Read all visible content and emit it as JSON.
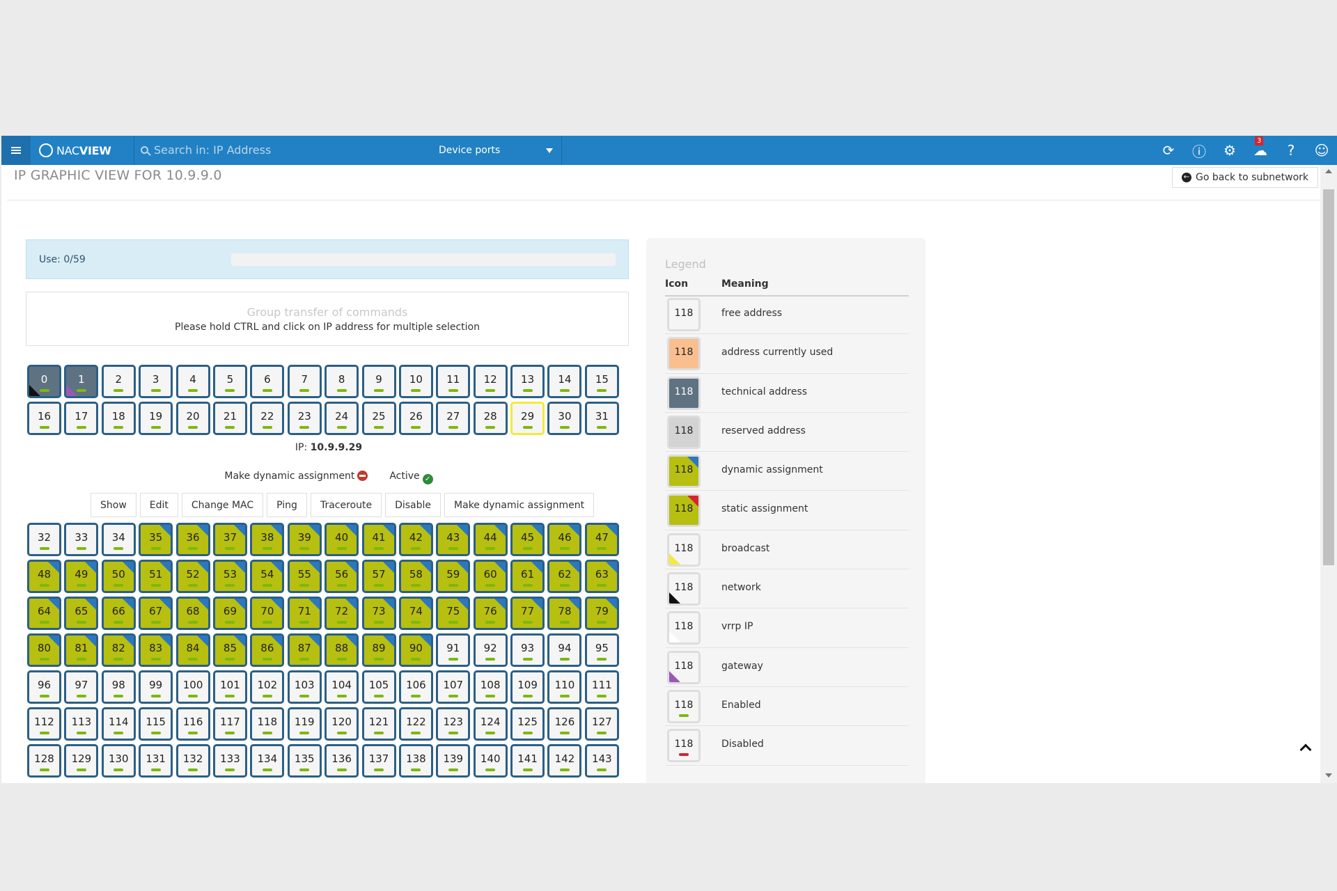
{
  "navbar": {
    "logo_prefix": "NAC",
    "logo_suffix": "VIEW",
    "search_placeholder": "Search in: IP Address",
    "device_select": "Device ports",
    "notification_count": "3",
    "icons": [
      "refresh-icon",
      "alert-icon",
      "gear-icon",
      "notification-icon",
      "help-icon",
      "user-icon"
    ]
  },
  "page": {
    "title": "IP GRAPHIC VIEW FOR 10.9.9.0",
    "back_button": "Go back to subnetwork"
  },
  "usage": {
    "label": "Use: 0/59",
    "percent": 0
  },
  "group": {
    "title": "Group transfer of commands",
    "hint": "Please hold CTRL and click on IP address for multiple selection"
  },
  "selected": {
    "ip_label": "IP:",
    "ip": "10.9.9.29",
    "dynamic_label": "Make dynamic assignment",
    "active_label": "Active"
  },
  "actions": [
    "Show",
    "Edit",
    "Change MAC",
    "Ping",
    "Traceroute",
    "Disable",
    "Make dynamic assignment"
  ],
  "ip_grid_top": [
    {
      "n": "0",
      "t": "tech net"
    },
    {
      "n": "1",
      "t": "tech gw"
    },
    {
      "n": "2",
      "t": ""
    },
    {
      "n": "3",
      "t": ""
    },
    {
      "n": "4",
      "t": ""
    },
    {
      "n": "5",
      "t": ""
    },
    {
      "n": "6",
      "t": ""
    },
    {
      "n": "7",
      "t": ""
    },
    {
      "n": "8",
      "t": ""
    },
    {
      "n": "9",
      "t": ""
    },
    {
      "n": "10",
      "t": ""
    },
    {
      "n": "11",
      "t": ""
    },
    {
      "n": "12",
      "t": ""
    },
    {
      "n": "13",
      "t": ""
    },
    {
      "n": "14",
      "t": ""
    },
    {
      "n": "15",
      "t": ""
    },
    {
      "n": "16",
      "t": ""
    },
    {
      "n": "17",
      "t": ""
    },
    {
      "n": "18",
      "t": ""
    },
    {
      "n": "19",
      "t": ""
    },
    {
      "n": "20",
      "t": ""
    },
    {
      "n": "21",
      "t": ""
    },
    {
      "n": "22",
      "t": ""
    },
    {
      "n": "23",
      "t": ""
    },
    {
      "n": "24",
      "t": ""
    },
    {
      "n": "25",
      "t": ""
    },
    {
      "n": "26",
      "t": ""
    },
    {
      "n": "27",
      "t": ""
    },
    {
      "n": "28",
      "t": ""
    },
    {
      "n": "29",
      "t": "selected"
    },
    {
      "n": "30",
      "t": ""
    },
    {
      "n": "31",
      "t": ""
    }
  ],
  "ip_grid_bottom": [
    {
      "n": "32",
      "t": ""
    },
    {
      "n": "33",
      "t": ""
    },
    {
      "n": "34",
      "t": ""
    },
    {
      "n": "35",
      "t": "dyn"
    },
    {
      "n": "36",
      "t": "dyn"
    },
    {
      "n": "37",
      "t": "dyn"
    },
    {
      "n": "38",
      "t": "dyn"
    },
    {
      "n": "39",
      "t": "dyn"
    },
    {
      "n": "40",
      "t": "dyn"
    },
    {
      "n": "41",
      "t": "dyn"
    },
    {
      "n": "42",
      "t": "dyn"
    },
    {
      "n": "43",
      "t": "dyn"
    },
    {
      "n": "44",
      "t": "dyn"
    },
    {
      "n": "45",
      "t": "dyn"
    },
    {
      "n": "46",
      "t": "dyn"
    },
    {
      "n": "47",
      "t": "dyn"
    },
    {
      "n": "48",
      "t": "dyn"
    },
    {
      "n": "49",
      "t": "dyn"
    },
    {
      "n": "50",
      "t": "dyn"
    },
    {
      "n": "51",
      "t": "dyn"
    },
    {
      "n": "52",
      "t": "dyn"
    },
    {
      "n": "53",
      "t": "dyn"
    },
    {
      "n": "54",
      "t": "dyn"
    },
    {
      "n": "55",
      "t": "dyn"
    },
    {
      "n": "56",
      "t": "dyn"
    },
    {
      "n": "57",
      "t": "dyn"
    },
    {
      "n": "58",
      "t": "dyn"
    },
    {
      "n": "59",
      "t": "dyn"
    },
    {
      "n": "60",
      "t": "dyn"
    },
    {
      "n": "61",
      "t": "dyn"
    },
    {
      "n": "62",
      "t": "dyn"
    },
    {
      "n": "63",
      "t": "dyn"
    },
    {
      "n": "64",
      "t": "dyn"
    },
    {
      "n": "65",
      "t": "dyn"
    },
    {
      "n": "66",
      "t": "dyn"
    },
    {
      "n": "67",
      "t": "dyn"
    },
    {
      "n": "68",
      "t": "dyn"
    },
    {
      "n": "69",
      "t": "dyn"
    },
    {
      "n": "70",
      "t": "dyn"
    },
    {
      "n": "71",
      "t": "dyn"
    },
    {
      "n": "72",
      "t": "dyn"
    },
    {
      "n": "73",
      "t": "dyn"
    },
    {
      "n": "74",
      "t": "dyn"
    },
    {
      "n": "75",
      "t": "dyn"
    },
    {
      "n": "76",
      "t": "dyn"
    },
    {
      "n": "77",
      "t": "dyn"
    },
    {
      "n": "78",
      "t": "dyn"
    },
    {
      "n": "79",
      "t": "dyn"
    },
    {
      "n": "80",
      "t": "dyn"
    },
    {
      "n": "81",
      "t": "dyn"
    },
    {
      "n": "82",
      "t": "dyn"
    },
    {
      "n": "83",
      "t": "dyn"
    },
    {
      "n": "84",
      "t": "dyn"
    },
    {
      "n": "85",
      "t": "dyn"
    },
    {
      "n": "86",
      "t": "dyn"
    },
    {
      "n": "87",
      "t": "dyn"
    },
    {
      "n": "88",
      "t": "dyn"
    },
    {
      "n": "89",
      "t": "dyn"
    },
    {
      "n": "90",
      "t": "dyn"
    },
    {
      "n": "91",
      "t": ""
    },
    {
      "n": "92",
      "t": ""
    },
    {
      "n": "93",
      "t": ""
    },
    {
      "n": "94",
      "t": ""
    },
    {
      "n": "95",
      "t": ""
    },
    {
      "n": "96",
      "t": ""
    },
    {
      "n": "97",
      "t": ""
    },
    {
      "n": "98",
      "t": ""
    },
    {
      "n": "99",
      "t": ""
    },
    {
      "n": "100",
      "t": ""
    },
    {
      "n": "101",
      "t": ""
    },
    {
      "n": "102",
      "t": ""
    },
    {
      "n": "103",
      "t": ""
    },
    {
      "n": "104",
      "t": ""
    },
    {
      "n": "105",
      "t": ""
    },
    {
      "n": "106",
      "t": ""
    },
    {
      "n": "107",
      "t": ""
    },
    {
      "n": "108",
      "t": ""
    },
    {
      "n": "109",
      "t": ""
    },
    {
      "n": "110",
      "t": ""
    },
    {
      "n": "111",
      "t": ""
    },
    {
      "n": "112",
      "t": ""
    },
    {
      "n": "113",
      "t": ""
    },
    {
      "n": "114",
      "t": ""
    },
    {
      "n": "115",
      "t": ""
    },
    {
      "n": "116",
      "t": ""
    },
    {
      "n": "117",
      "t": ""
    },
    {
      "n": "118",
      "t": ""
    },
    {
      "n": "119",
      "t": ""
    },
    {
      "n": "120",
      "t": ""
    },
    {
      "n": "121",
      "t": ""
    },
    {
      "n": "122",
      "t": ""
    },
    {
      "n": "123",
      "t": ""
    },
    {
      "n": "124",
      "t": ""
    },
    {
      "n": "125",
      "t": ""
    },
    {
      "n": "126",
      "t": ""
    },
    {
      "n": "127",
      "t": ""
    },
    {
      "n": "128",
      "t": ""
    },
    {
      "n": "129",
      "t": ""
    },
    {
      "n": "130",
      "t": ""
    },
    {
      "n": "131",
      "t": ""
    },
    {
      "n": "132",
      "t": ""
    },
    {
      "n": "133",
      "t": ""
    },
    {
      "n": "134",
      "t": ""
    },
    {
      "n": "135",
      "t": ""
    },
    {
      "n": "136",
      "t": ""
    },
    {
      "n": "137",
      "t": ""
    },
    {
      "n": "138",
      "t": ""
    },
    {
      "n": "139",
      "t": ""
    },
    {
      "n": "140",
      "t": ""
    },
    {
      "n": "141",
      "t": ""
    },
    {
      "n": "142",
      "t": ""
    },
    {
      "n": "143",
      "t": ""
    }
  ],
  "legend": {
    "title": "Legend",
    "col_icon": "Icon",
    "col_meaning": "Meaning",
    "sample": "118",
    "rows": [
      {
        "cls": "",
        "meaning": "free address"
      },
      {
        "cls": "used",
        "meaning": "address currently used"
      },
      {
        "cls": "tech",
        "meaning": "technical address"
      },
      {
        "cls": "reserved",
        "meaning": "reserved address"
      },
      {
        "cls": "dyn",
        "meaning": "dynamic assignment"
      },
      {
        "cls": "dyn static",
        "meaning": "static assignment"
      },
      {
        "cls": "brc",
        "meaning": "broadcast"
      },
      {
        "cls": "net",
        "meaning": "network"
      },
      {
        "cls": "vrrp",
        "meaning": "vrrp IP"
      },
      {
        "cls": "gw",
        "meaning": "gateway"
      },
      {
        "cls": "en",
        "meaning": "Enabled"
      },
      {
        "cls": "dis",
        "meaning": "Disabled"
      }
    ]
  },
  "colors": {
    "navbar": "#2181c4",
    "dynamic": "#b7bf10",
    "technical": "#5f7282",
    "used": "#f9bf8f",
    "reserved": "#d3d3d3",
    "static_corner": "#d9232d",
    "dynamic_corner": "#2b78c0"
  }
}
